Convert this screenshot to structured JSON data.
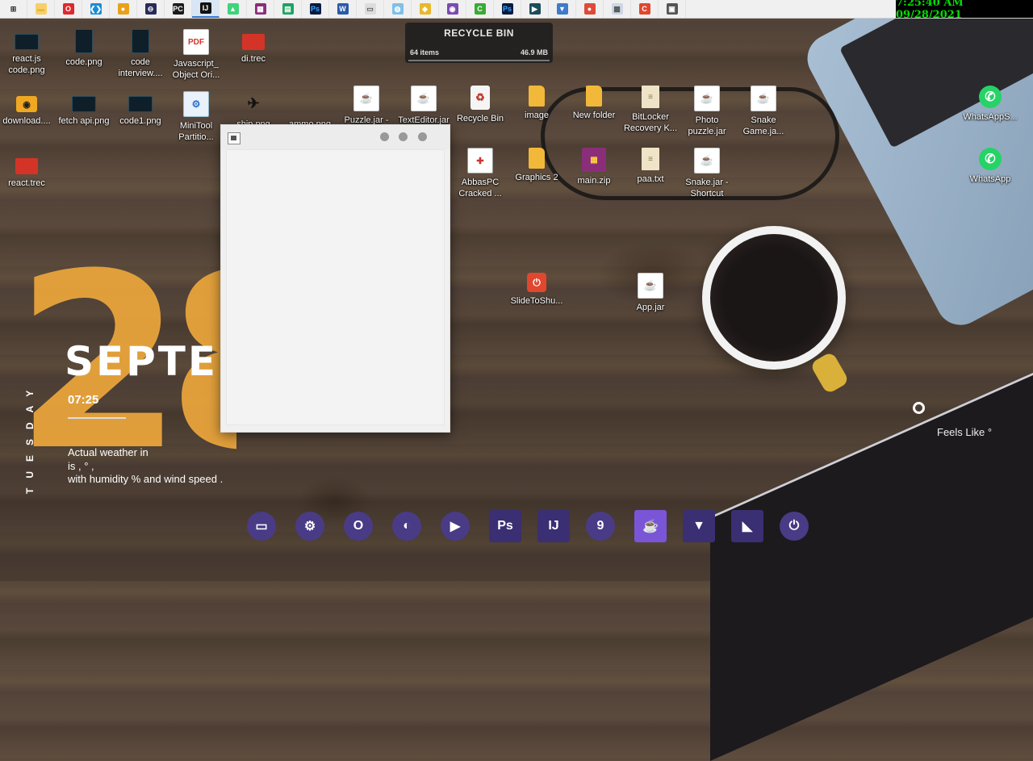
{
  "taskbar": {
    "apps": [
      {
        "name": "start",
        "glyph": "⊞",
        "color": "#2c2c2c",
        "bg": "transparent"
      },
      {
        "name": "file-explorer",
        "glyph": "▬",
        "color": "#e5b73b",
        "bg": "#f7d06a"
      },
      {
        "name": "opera",
        "glyph": "O",
        "color": "#fff",
        "bg": "#e0282e"
      },
      {
        "name": "vscode",
        "glyph": "❮❯",
        "color": "#fff",
        "bg": "#1c8cd8"
      },
      {
        "name": "chrome",
        "glyph": "●",
        "color": "#fff",
        "bg": "#e8a21a"
      },
      {
        "name": "circle-app",
        "glyph": "⊖",
        "color": "#fff",
        "bg": "#2a2a5a"
      },
      {
        "name": "pycharm",
        "glyph": "PC",
        "color": "#fff",
        "bg": "#1b1b1b"
      },
      {
        "name": "intellij",
        "glyph": "IJ",
        "color": "#fff",
        "bg": "#111"
      },
      {
        "name": "android",
        "glyph": "▲",
        "color": "#fff",
        "bg": "#3dd47a"
      },
      {
        "name": "winrar",
        "glyph": "▦",
        "color": "#fff",
        "bg": "#8a2e7a"
      },
      {
        "name": "sheets",
        "glyph": "▤",
        "color": "#fff",
        "bg": "#1ea362"
      },
      {
        "name": "photoshop",
        "glyph": "Ps",
        "color": "#31a8ff",
        "bg": "#0a1b3f"
      },
      {
        "name": "word",
        "glyph": "W",
        "color": "#fff",
        "bg": "#2b5aa8"
      },
      {
        "name": "screenshot",
        "glyph": "▭",
        "color": "#555",
        "bg": "#ddd"
      },
      {
        "name": "paint",
        "glyph": "◍",
        "color": "#fff",
        "bg": "#7fc0e8"
      },
      {
        "name": "folder-yellow",
        "glyph": "◆",
        "color": "#fff",
        "bg": "#e8b92a"
      },
      {
        "name": "tor",
        "glyph": "◉",
        "color": "#fff",
        "bg": "#7a4bb0"
      },
      {
        "name": "green-c",
        "glyph": "C",
        "color": "#fff",
        "bg": "#3aaa35"
      },
      {
        "name": "photoshop2",
        "glyph": "Ps",
        "color": "#31a8ff",
        "bg": "#0a1b3f"
      },
      {
        "name": "monitor",
        "glyph": "▶",
        "color": "#fff",
        "bg": "#1b4d5a"
      },
      {
        "name": "download",
        "glyph": "▼",
        "color": "#fff",
        "bg": "#3e7bc9"
      },
      {
        "name": "chrome2",
        "glyph": "●",
        "color": "#fff",
        "bg": "#dd4b39"
      },
      {
        "name": "network",
        "glyph": "▩",
        "color": "#555",
        "bg": "#ccd8e4"
      },
      {
        "name": "c-red",
        "glyph": "C",
        "color": "#fff",
        "bg": "#e0482e"
      },
      {
        "name": "java-app",
        "glyph": "▣",
        "color": "#fff",
        "bg": "#555"
      }
    ],
    "active_index": 7,
    "clock": "7:25:40 AM 09/28/2021"
  },
  "recycle_widget": {
    "title": "RECYCLE BIN",
    "items": "64 items",
    "size": "46.9 MB"
  },
  "desktop_icons": [
    {
      "id": "react-js-code-png",
      "label": "react.js code.png",
      "kind": "shot",
      "glyph": ""
    },
    {
      "id": "code-png",
      "label": "code.png",
      "kind": "shot-tall",
      "glyph": ""
    },
    {
      "id": "code-interview",
      "label": "code interview....",
      "kind": "shot-tall",
      "glyph": ""
    },
    {
      "id": "javascript-object",
      "label": "Javascript_ Object Ori...",
      "kind": "pdf",
      "glyph": "PDF"
    },
    {
      "id": "di-trec",
      "label": "di.trec",
      "kind": "red",
      "glyph": ""
    },
    {
      "id": "download",
      "label": "download....",
      "kind": "hp",
      "glyph": "◉"
    },
    {
      "id": "fetch-api-png",
      "label": "fetch api.png",
      "kind": "shot",
      "glyph": ""
    },
    {
      "id": "code1-png",
      "label": "code1.png",
      "kind": "shot",
      "glyph": ""
    },
    {
      "id": "minitool",
      "label": "MiniTool Partitio...",
      "kind": "mini",
      "glyph": "⚙"
    },
    {
      "id": "ship-png",
      "label": "ship.png",
      "kind": "ship",
      "glyph": "✈"
    },
    {
      "id": "ammo-png",
      "label": "ammo.png",
      "kind": "none",
      "glyph": ""
    },
    {
      "id": "puzzle-jar",
      "label": "Puzzle.jar -",
      "kind": "jar",
      "glyph": "☕"
    },
    {
      "id": "texteditor-jar",
      "label": "TextEditor.jar",
      "kind": "jar",
      "glyph": "☕"
    },
    {
      "id": "recycle-bin",
      "label": "Recycle Bin",
      "kind": "bin",
      "glyph": "♻"
    },
    {
      "id": "image-folder",
      "label": "image",
      "kind": "folder",
      "glyph": ""
    },
    {
      "id": "new-folder",
      "label": "New folder",
      "kind": "folder",
      "glyph": ""
    },
    {
      "id": "bitlocker",
      "label": "BitLocker Recovery K...",
      "kind": "file",
      "glyph": "≡"
    },
    {
      "id": "photo-puzzle-jar",
      "label": "Photo puzzle.jar",
      "kind": "jar",
      "glyph": "☕"
    },
    {
      "id": "snake-game-jar",
      "label": "Snake Game.ja...",
      "kind": "jar",
      "glyph": "☕"
    },
    {
      "id": "whatsapps",
      "label": "WhatsAppS...",
      "kind": "wa",
      "glyph": "✆"
    },
    {
      "id": "react-trec",
      "label": "react.trec",
      "kind": "red",
      "glyph": ""
    },
    {
      "id": "abbaspc-cracked",
      "label": "AbbasPC Cracked ...",
      "kind": "cracked",
      "glyph": "✚"
    },
    {
      "id": "graphics-2",
      "label": "Graphics 2",
      "kind": "folder",
      "glyph": ""
    },
    {
      "id": "main-zip",
      "label": "main.zip",
      "kind": "zip",
      "glyph": "▦"
    },
    {
      "id": "paa-txt",
      "label": "paa.txt",
      "kind": "file",
      "glyph": "≡"
    },
    {
      "id": "snake-jar-shortcut",
      "label": "Snake.jar - Shortcut",
      "kind": "jar",
      "glyph": "☕"
    },
    {
      "id": "whatsapp",
      "label": "WhatsApp",
      "kind": "wa",
      "glyph": "✆"
    },
    {
      "id": "slidetoshutdown",
      "label": "SlideToShu...",
      "kind": "slide",
      "glyph": "⏻"
    },
    {
      "id": "app-jar",
      "label": "App.jar",
      "kind": "jar",
      "glyph": "☕"
    }
  ],
  "date_widget": {
    "day": "28",
    "month": "SEPTE",
    "weekday": "TUESDAY",
    "time": "07:25",
    "weather_line1": "Actual weather in",
    "weather_line2": "is , ° ,",
    "weather_line3": "with humidity  % and wind speed   .",
    "feels_like": "Feels Like °"
  },
  "dock": [
    {
      "name": "dock-files",
      "glyph": "▭",
      "shape": "round"
    },
    {
      "name": "dock-settings",
      "glyph": "⚙",
      "shape": "round"
    },
    {
      "name": "dock-opera",
      "glyph": "O",
      "shape": "round"
    },
    {
      "name": "dock-firefox",
      "glyph": "◐",
      "shape": "round"
    },
    {
      "name": "dock-youtube",
      "glyph": "▶",
      "shape": "round"
    },
    {
      "name": "dock-photoshop",
      "glyph": "Ps",
      "shape": "sq"
    },
    {
      "name": "dock-intellij",
      "glyph": "IJ",
      "shape": "sq"
    },
    {
      "name": "dock-9",
      "glyph": "9",
      "shape": "round"
    },
    {
      "name": "dock-java",
      "glyph": "☕",
      "shape": "sqhl"
    },
    {
      "name": "dock-download",
      "glyph": "▼",
      "shape": "sq"
    },
    {
      "name": "dock-vs",
      "glyph": "◣",
      "shape": "sq"
    },
    {
      "name": "dock-power",
      "glyph": "⏻",
      "shape": "round"
    }
  ]
}
